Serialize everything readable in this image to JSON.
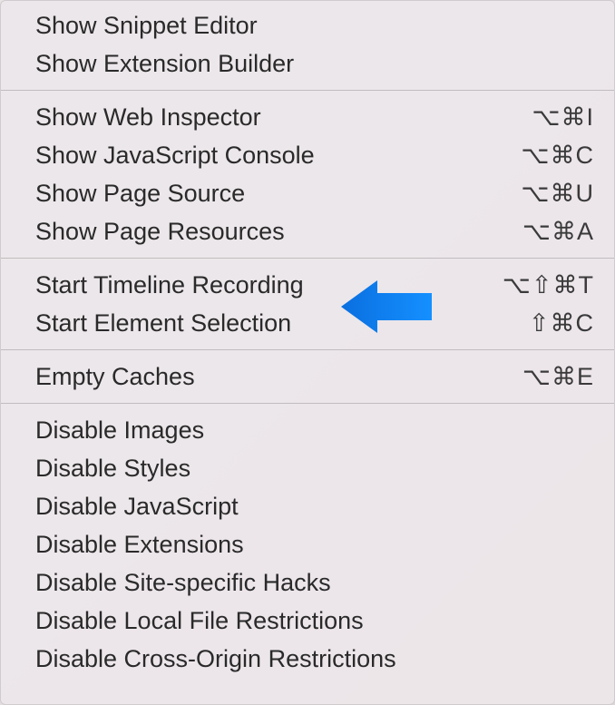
{
  "menu": {
    "groups": [
      {
        "items": [
          {
            "label": "Show Snippet Editor",
            "shortcut": ""
          },
          {
            "label": "Show Extension Builder",
            "shortcut": ""
          }
        ]
      },
      {
        "items": [
          {
            "label": "Show Web Inspector",
            "shortcut": "⌥⌘I"
          },
          {
            "label": "Show JavaScript Console",
            "shortcut": "⌥⌘C"
          },
          {
            "label": "Show Page Source",
            "shortcut": "⌥⌘U"
          },
          {
            "label": "Show Page Resources",
            "shortcut": "⌥⌘A"
          }
        ]
      },
      {
        "items": [
          {
            "label": "Start Timeline Recording",
            "shortcut": "⌥⇧⌘T"
          },
          {
            "label": "Start Element Selection",
            "shortcut": "⇧⌘C"
          }
        ]
      },
      {
        "items": [
          {
            "label": "Empty Caches",
            "shortcut": "⌥⌘E"
          }
        ]
      },
      {
        "items": [
          {
            "label": "Disable Images",
            "shortcut": ""
          },
          {
            "label": "Disable Styles",
            "shortcut": ""
          },
          {
            "label": "Disable JavaScript",
            "shortcut": ""
          },
          {
            "label": "Disable Extensions",
            "shortcut": ""
          },
          {
            "label": "Disable Site-specific Hacks",
            "shortcut": ""
          },
          {
            "label": "Disable Local File Restrictions",
            "shortcut": ""
          },
          {
            "label": "Disable Cross-Origin Restrictions",
            "shortcut": ""
          }
        ]
      }
    ]
  },
  "callout": {
    "points_to": "Start Element Selection",
    "color": "#0a84ff"
  }
}
